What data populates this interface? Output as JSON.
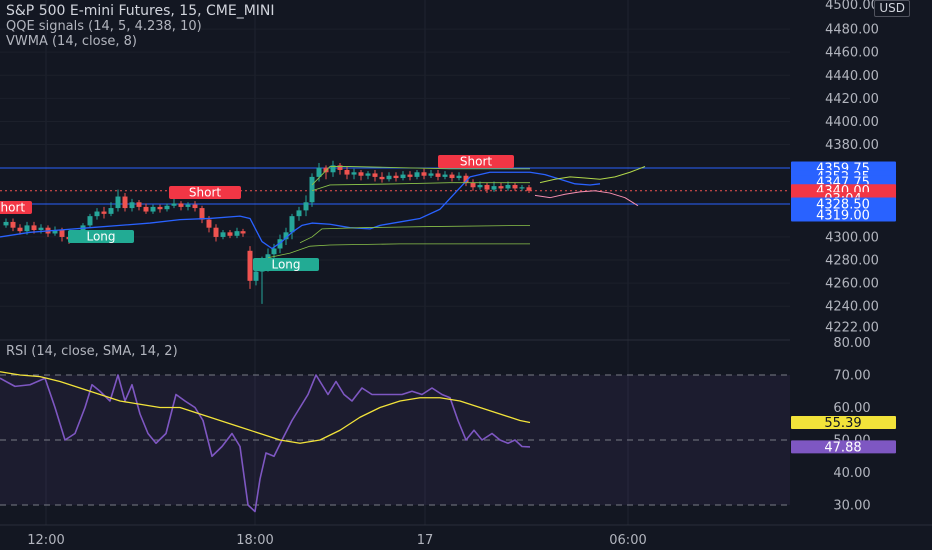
{
  "legend": {
    "symbol": "S&P 500 E-mini Futures, 15, CME_MINI",
    "qqe": "QQE signals (14, 5, 4.238, 10)",
    "vwma": "VWMA (14, close, 8)",
    "rsi": "RSI (14, close, SMA, 14, 2)"
  },
  "currency": "USD",
  "colors": {
    "background": "#131722",
    "up": "#26a69a",
    "down": "#ef5350",
    "blue_line": "#2962ff",
    "rsi_line": "#7e57c2",
    "rsi_ma": "#f2e33a",
    "short_badge": "#f23645",
    "long_badge": "#22ab94"
  },
  "price_axis": {
    "ticks": [
      "4480.00",
      "4460.00",
      "4440.00",
      "4420.00",
      "4400.00",
      "4380.00",
      "4300.00",
      "4280.00",
      "4260.00",
      "4240.00",
      "4222.00"
    ],
    "top_partial": "4500.00",
    "badges": [
      {
        "label": "4359.75",
        "value": 4359.75,
        "color": "#2962ff"
      },
      {
        "label": "4352.25",
        "value": 4352.25,
        "color": "#2962ff"
      },
      {
        "label": "4347.75",
        "value": 4347.75,
        "color": "#2962ff"
      },
      {
        "label": "4340.00",
        "value": 4340.0,
        "color": "#f23645"
      },
      {
        "label": "03:04",
        "value": 4333.2,
        "color": "#f23645"
      },
      {
        "label": "4328.50",
        "value": 4328.5,
        "color": "#2962ff"
      },
      {
        "label": "4319.00",
        "value": 4319.0,
        "color": "#2962ff"
      }
    ]
  },
  "rsi_axis": {
    "ticks": [
      "80.00",
      "70.00",
      "60.00",
      "50.00",
      "40.00",
      "30.00"
    ],
    "badges": [
      {
        "label": "55.39",
        "value": 55.39,
        "color": "#f2e33a",
        "text": "#131722"
      },
      {
        "label": "47.88",
        "value": 47.88,
        "color": "#7e57c2",
        "text": "#ffffff"
      }
    ]
  },
  "time_axis": [
    "12:00",
    "18:00",
    "17",
    "06:00"
  ],
  "signals": [
    {
      "label": "Short",
      "type": "short"
    },
    {
      "label": "Short",
      "type": "short"
    },
    {
      "label": "Short",
      "type": "short"
    },
    {
      "label": "Long",
      "type": "long"
    },
    {
      "label": "Long",
      "type": "long"
    }
  ],
  "chart_data": [
    {
      "type": "line",
      "title": "S&P 500 E-mini Futures, 15, CME_MINI",
      "ylim": [
        4222,
        4500
      ],
      "series": [
        {
          "name": "QQE signals (14, 5, 4.238, 10)",
          "note": "candlesticks"
        },
        {
          "name": "VWMA (14, close, 8)"
        }
      ],
      "horizontal_levels": [
        4359.75,
        4328.5,
        4340.0
      ]
    },
    {
      "type": "line",
      "title": "RSI (14, close, SMA, 14, 2)",
      "ylim": [
        25,
        80
      ],
      "reference_levels": [
        70,
        50,
        30
      ],
      "x": [
        "12:00",
        "18:00",
        "17",
        "06:00"
      ],
      "series": [
        {
          "name": "RSI",
          "last": 47.88
        },
        {
          "name": "SMA",
          "last": 55.39
        }
      ]
    }
  ]
}
